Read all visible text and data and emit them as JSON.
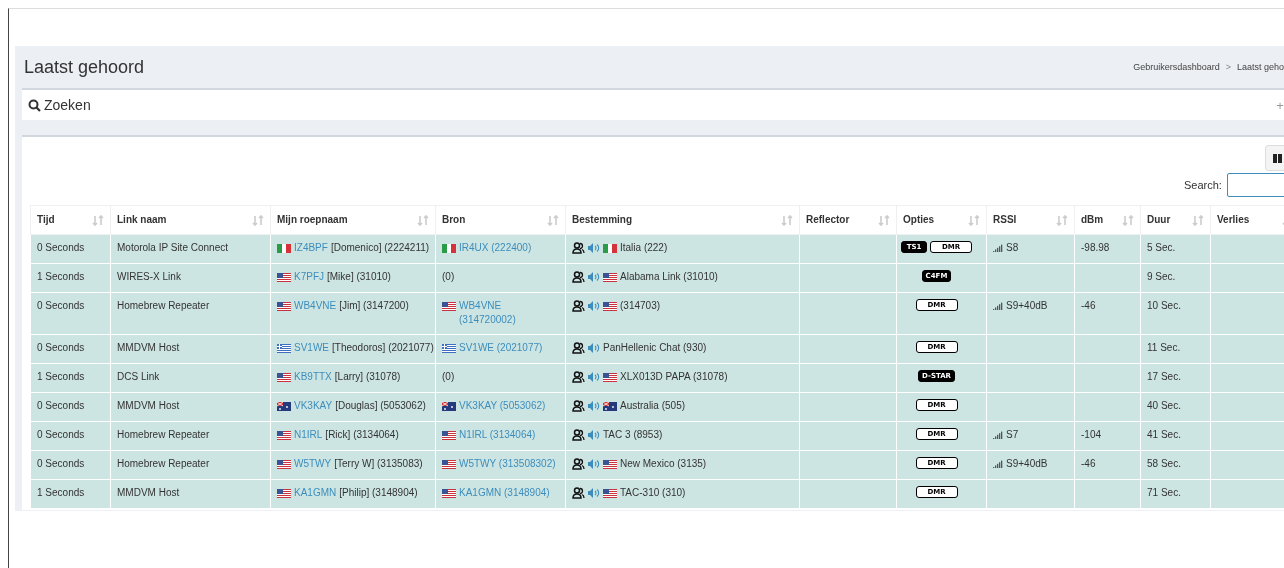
{
  "header": {
    "title": "Laatst gehoord",
    "breadcrumb": [
      "Gebruikersdashboard",
      "Laatst geho"
    ],
    "separator": ">"
  },
  "search_panel": {
    "title": "Zoeken",
    "toggle": "+"
  },
  "table_tools": {
    "search_label": "Search:"
  },
  "table": {
    "columns": [
      "Tijd",
      "Link naam",
      "Mijn roepnaam",
      "Bron",
      "Bestemming",
      "Reflector",
      "Opties",
      "RSSI",
      "dBm",
      "Duur",
      "Verlies"
    ],
    "rows": [
      {
        "time": "0 Seconds",
        "link": "Motorola IP Site Connect",
        "callsign": {
          "flag": {
            "kind": "italy"
          },
          "call": "IZ4BPF",
          "rest": "[Domenico] (2224211)"
        },
        "source": {
          "kind": "link",
          "flag": {
            "kind": "italy"
          },
          "text": "IR4UX (222400)"
        },
        "destination": {
          "flag": {
            "kind": "italy"
          },
          "text": "Italia (222)"
        },
        "options": [
          {
            "label": "TS1",
            "filled": true
          },
          {
            "label": "DMR",
            "filled": false
          }
        ],
        "rssi": "S8",
        "dbm": "-98.98",
        "duration": "5 Sec."
      },
      {
        "time": "1 Seconds",
        "link": "WIRES-X Link",
        "callsign": {
          "flag": {
            "kind": "usa"
          },
          "call": "K7PFJ",
          "rest": "[Mike] (31010)"
        },
        "source": {
          "kind": "plain",
          "text": "(0)"
        },
        "destination": {
          "flag": {
            "kind": "usa"
          },
          "text": "Alabama Link (31010)"
        },
        "options": [
          {
            "label": "C4FM",
            "filled": true
          }
        ],
        "duration": "9 Sec."
      },
      {
        "time": "0 Seconds",
        "link": "Homebrew Repeater",
        "callsign": {
          "flag": {
            "kind": "usa"
          },
          "call": "WB4VNE",
          "rest": "[Jim] (3147200)"
        },
        "source": {
          "kind": "link",
          "flag": {
            "kind": "usa"
          },
          "text": "WB4VNE (314720002)"
        },
        "destination": {
          "flag": {
            "kind": "usa"
          },
          "text": "(314703)"
        },
        "options": [
          {
            "label": "DMR",
            "filled": false
          }
        ],
        "rssi": "S9+40dB",
        "dbm": "-46",
        "duration": "10 Sec."
      },
      {
        "time": "0 Seconds",
        "link": "MMDVM Host",
        "callsign": {
          "flag": {
            "kind": "greece"
          },
          "call": "SV1WE",
          "rest": "[Theodoros] (2021077)"
        },
        "source": {
          "kind": "link",
          "flag": {
            "kind": "greece"
          },
          "text": "SV1WE (2021077)"
        },
        "destination": {
          "text": "PanHellenic Chat (930)"
        },
        "options": [
          {
            "label": "DMR",
            "filled": false
          }
        ],
        "duration": "11 Sec."
      },
      {
        "time": "1 Seconds",
        "link": "DCS Link",
        "callsign": {
          "flag": {
            "kind": "usa"
          },
          "call": "KB9TTX",
          "rest": "[Larry] (31078)"
        },
        "source": {
          "kind": "plain",
          "text": "(0)"
        },
        "destination": {
          "flag": {
            "kind": "usa"
          },
          "text": "XLX013D PAPA (31078)"
        },
        "options": [
          {
            "label": "D-STAR",
            "filled": true
          }
        ],
        "duration": "17 Sec."
      },
      {
        "time": "0 Seconds",
        "link": "MMDVM Host",
        "callsign": {
          "flag": {
            "kind": "australia"
          },
          "call": "VK3KAY",
          "rest": "[Douglas] (5053062)"
        },
        "source": {
          "kind": "link",
          "flag": {
            "kind": "australia"
          },
          "text": "VK3KAY (5053062)"
        },
        "destination": {
          "flag": {
            "kind": "australia"
          },
          "text": "Australia (505)"
        },
        "options": [
          {
            "label": "DMR",
            "filled": false
          }
        ],
        "duration": "40 Sec."
      },
      {
        "time": "0 Seconds",
        "link": "Homebrew Repeater",
        "callsign": {
          "flag": {
            "kind": "usa"
          },
          "call": "N1IRL",
          "rest": "[Rick] (3134064)"
        },
        "source": {
          "kind": "link",
          "flag": {
            "kind": "usa"
          },
          "text": "N1IRL (3134064)"
        },
        "destination": {
          "text": "TAC 3 (8953)"
        },
        "options": [
          {
            "label": "DMR",
            "filled": false
          }
        ],
        "rssi": "S7",
        "dbm": "-104",
        "duration": "41 Sec."
      },
      {
        "time": "0 Seconds",
        "link": "Homebrew Repeater",
        "callsign": {
          "flag": {
            "kind": "usa"
          },
          "call": "W5TWY",
          "rest": "[Terry W] (3135083)"
        },
        "source": {
          "kind": "link",
          "flag": {
            "kind": "usa"
          },
          "text": "W5TWY (313508302)"
        },
        "destination": {
          "flag": {
            "kind": "usa"
          },
          "text": "New Mexico (3135)"
        },
        "options": [
          {
            "label": "DMR",
            "filled": false
          }
        ],
        "rssi": "S9+40dB",
        "dbm": "-46",
        "duration": "58 Sec."
      },
      {
        "time": "1 Seconds",
        "link": "MMDVM Host",
        "callsign": {
          "flag": {
            "kind": "usa"
          },
          "call": "KA1GMN",
          "rest": "[Philip] (3148904)"
        },
        "source": {
          "kind": "link",
          "flag": {
            "kind": "usa"
          },
          "text": "KA1GMN (3148904)"
        },
        "destination": {
          "flag": {
            "kind": "usa"
          },
          "text": "TAC-310 (310)"
        },
        "options": [
          {
            "label": "DMR",
            "filled": false
          }
        ],
        "duration": "71 Sec."
      }
    ]
  }
}
